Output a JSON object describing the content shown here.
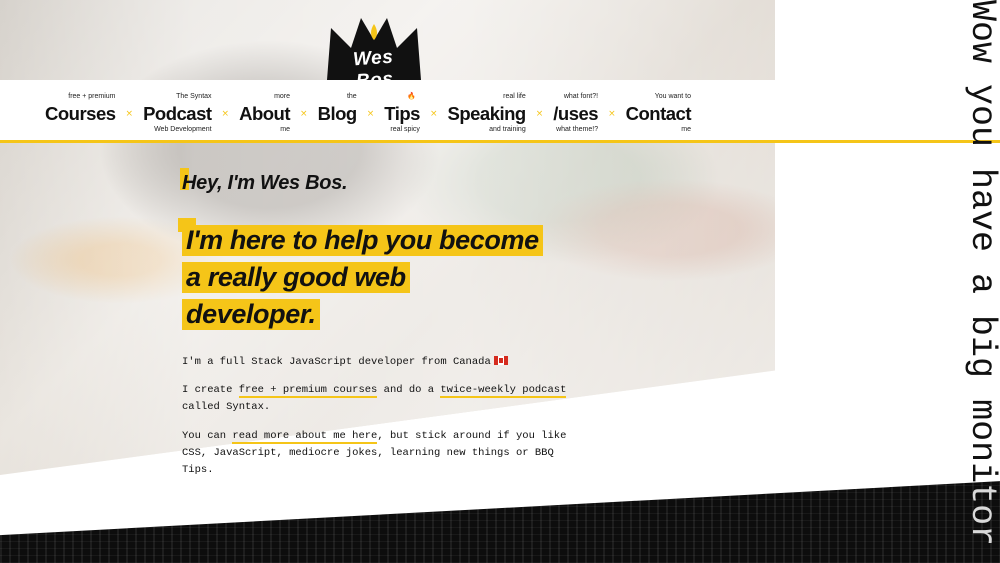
{
  "brand": {
    "logo_text": "Wes Bos",
    "accent": "#f5c518"
  },
  "nav": {
    "items": [
      {
        "label": "Courses",
        "top": "free + premium",
        "bottom": ""
      },
      {
        "label": "Podcast",
        "top": "The Syntax",
        "bottom": "Web Development"
      },
      {
        "label": "About",
        "top": "more",
        "bottom": "me"
      },
      {
        "label": "Blog",
        "top": "the",
        "bottom": ""
      },
      {
        "label": "Tips",
        "top": "🔥",
        "bottom": "real spicy"
      },
      {
        "label": "Speaking",
        "top": "real life",
        "bottom": "and training"
      },
      {
        "label": "/uses",
        "top": "what font?!",
        "bottom": "what theme!?"
      },
      {
        "label": "Contact",
        "top": "You want to",
        "bottom": "me"
      }
    ],
    "separator": "×"
  },
  "hero": {
    "greeting": "Hey, I'm Wes Bos.",
    "headline_lines": [
      "I'm here to help you become",
      "a really good web",
      "developer."
    ],
    "p1_text": "I'm a full Stack JavaScript developer from Canada",
    "p2": {
      "before": "I create ",
      "link1": "free + premium courses",
      "middle": " and do a ",
      "link2": "twice-weekly podcast",
      "after": " called Syntax."
    },
    "p3": {
      "before": "You can ",
      "link": "read more about me here",
      "after": ", but stick around if you like CSS, JavaScript, mediocre jokes, learning new things or BBQ Tips."
    }
  },
  "side_text": "Wow you have a big monitor"
}
